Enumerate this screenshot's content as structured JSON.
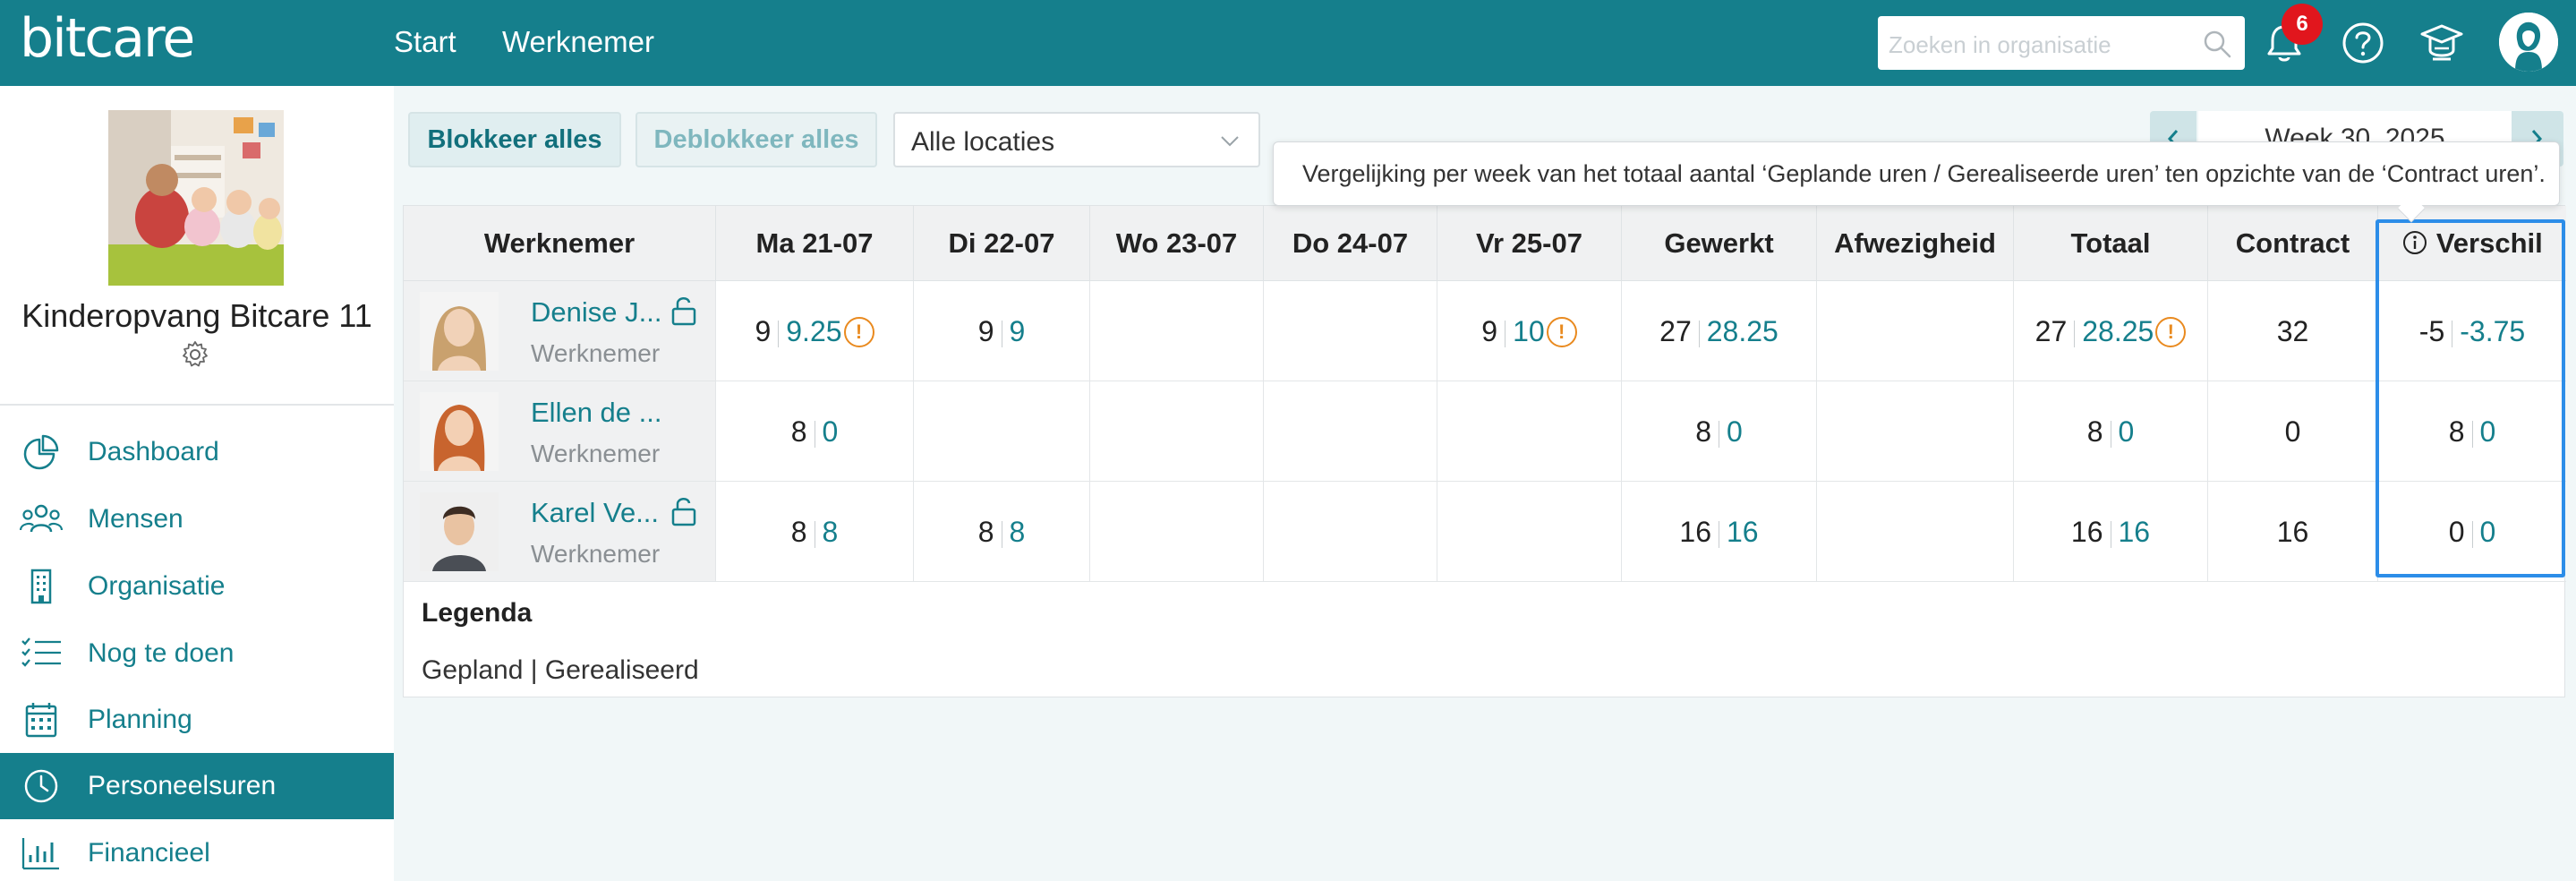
{
  "header": {
    "logo": "bitcare",
    "nav": [
      "Start",
      "Werknemer"
    ],
    "search_placeholder": "Zoeken in organisatie",
    "notifications_count": "6",
    "icons": [
      "bell-icon",
      "help-icon",
      "graduation-cap-icon",
      "user-avatar-icon"
    ]
  },
  "sidebar": {
    "org_name": "Kinderopvang Bitcare 11",
    "items": [
      {
        "label": "Dashboard",
        "icon": "pie-chart-icon",
        "active": false
      },
      {
        "label": "Mensen",
        "icon": "people-icon",
        "active": false
      },
      {
        "label": "Organisatie",
        "icon": "building-icon",
        "active": false
      },
      {
        "label": "Nog te doen",
        "icon": "checklist-icon",
        "active": false
      },
      {
        "label": "Planning",
        "icon": "calendar-icon",
        "active": false
      },
      {
        "label": "Personeelsuren",
        "icon": "clock-icon",
        "active": true
      },
      {
        "label": "Financieel",
        "icon": "bar-chart-icon",
        "active": false
      }
    ]
  },
  "toolbar": {
    "block_all": "Blokkeer alles",
    "unblock_all": "Deblokkeer alles",
    "location": "Alle locaties",
    "week": "Week 30, 2025"
  },
  "tooltip": "Vergelijking per week van het totaal aantal ‘Geplande uren / Gerealiseerde uren’ ten opzichte van de ‘Contract uren’.",
  "table": {
    "headers": [
      "Werknemer",
      "Ma 21-07",
      "Di 22-07",
      "Wo 23-07",
      "Do 24-07",
      "Vr 25-07",
      "Gewerkt",
      "Afwezigheid",
      "Totaal",
      "Contract",
      "Verschil"
    ],
    "rows": [
      {
        "name": "Denise J...",
        "role": "Werknemer",
        "locked": true,
        "ma": {
          "plan": "9",
          "real": "9.25",
          "warn": true
        },
        "di": {
          "plan": "9",
          "real": "9"
        },
        "vr": {
          "plan": "9",
          "real": "10",
          "warn": true
        },
        "gewerkt": {
          "plan": "27",
          "real": "28.25"
        },
        "totaal": {
          "plan": "27",
          "real": "28.25",
          "warn": true
        },
        "contract": "32",
        "verschil": {
          "plan": "-5",
          "real": "-3.75"
        }
      },
      {
        "name": "Ellen de ...",
        "role": "Werknemer",
        "locked": false,
        "ma": {
          "plan": "8",
          "real": "0"
        },
        "gewerkt": {
          "plan": "8",
          "real": "0"
        },
        "totaal": {
          "plan": "8",
          "real": "0"
        },
        "contract": "0",
        "verschil": {
          "plan": "8",
          "real": "0"
        }
      },
      {
        "name": "Karel Ve...",
        "role": "Werknemer",
        "locked": true,
        "ma": {
          "plan": "8",
          "real": "8"
        },
        "di": {
          "plan": "8",
          "real": "8"
        },
        "gewerkt": {
          "plan": "16",
          "real": "16"
        },
        "totaal": {
          "plan": "16",
          "real": "16"
        },
        "contract": "16",
        "verschil": {
          "plan": "0",
          "real": "0"
        }
      }
    ],
    "legend_title": "Legenda",
    "legend_text": "Gepland | Gerealiseerd"
  },
  "colors": {
    "brand": "#157f8c",
    "warning": "#e98a1f",
    "badge": "#e1161d",
    "highlight": "#2c8de8"
  }
}
